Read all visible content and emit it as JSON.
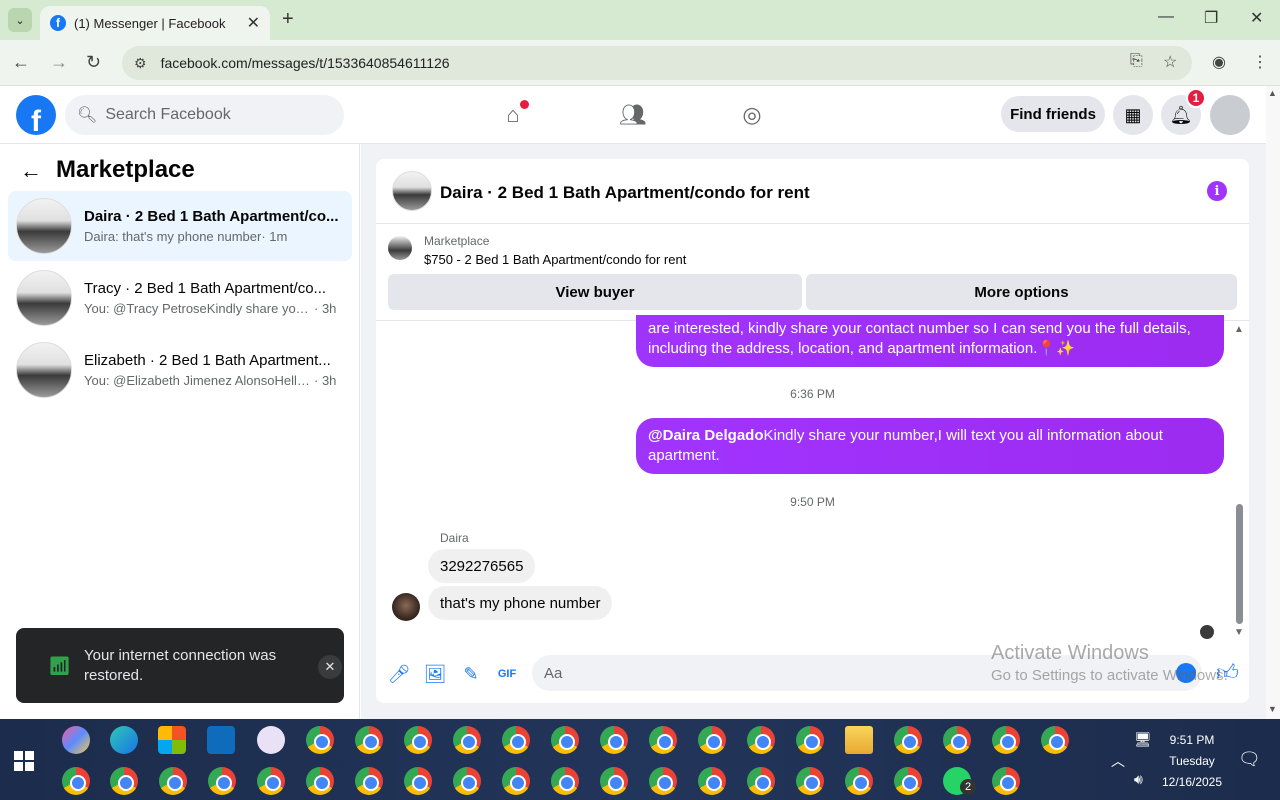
{
  "browser": {
    "tab_title": "(1) Messenger | Facebook",
    "url": "facebook.com/messages/t/1533640854611126"
  },
  "header": {
    "search_placeholder": "Search Facebook",
    "find_friends": "Find friends",
    "notification_count": "1"
  },
  "sidebar": {
    "title": "Marketplace",
    "conversations": [
      {
        "name": "Daira · 2 Bed 1 Bath Apartment/co...",
        "message": "Daira: that's my phone number",
        "time": "· 1m"
      },
      {
        "name": "Tracy · 2 Bed 1 Bath Apartment/co...",
        "message": "You: @Tracy PetroseKindly share your ...",
        "time": "· 3h"
      },
      {
        "name": "Elizabeth · 2 Bed 1 Bath Apartment...",
        "message": "You: @Elizabeth Jimenez AlonsoHello ...",
        "time": "· 3h"
      }
    ]
  },
  "toast": {
    "message": "Your internet connection was restored."
  },
  "chat": {
    "title": "Daira · 2 Bed 1 Bath Apartment/condo for rent",
    "marketplace_label": "Marketplace",
    "listing": "$750 - 2 Bed 1 Bath Apartment/condo for rent",
    "view_buyer": "View buyer",
    "more_options": "More options",
    "msg1": "are interested, kindly share your contact number so I can send you the full details, including the address, location, and apartment information.📍✨",
    "time1": "6:36 PM",
    "msg2_mention": "@Daira Delgado",
    "msg2_text": "Kindly share your number,I will text you all information about apartment.",
    "time2": "9:50 PM",
    "sender": "Daira",
    "in1": "3292276565",
    "in2": "that's my phone number",
    "composer_placeholder": "Aa"
  },
  "watermark": {
    "line1": "Activate Windows",
    "line2": "Go to Settings to activate Windows."
  },
  "taskbar": {
    "time": "9:51 PM",
    "day": "Tuesday",
    "date": "12/16/2025",
    "whatsapp_badge": "2"
  }
}
